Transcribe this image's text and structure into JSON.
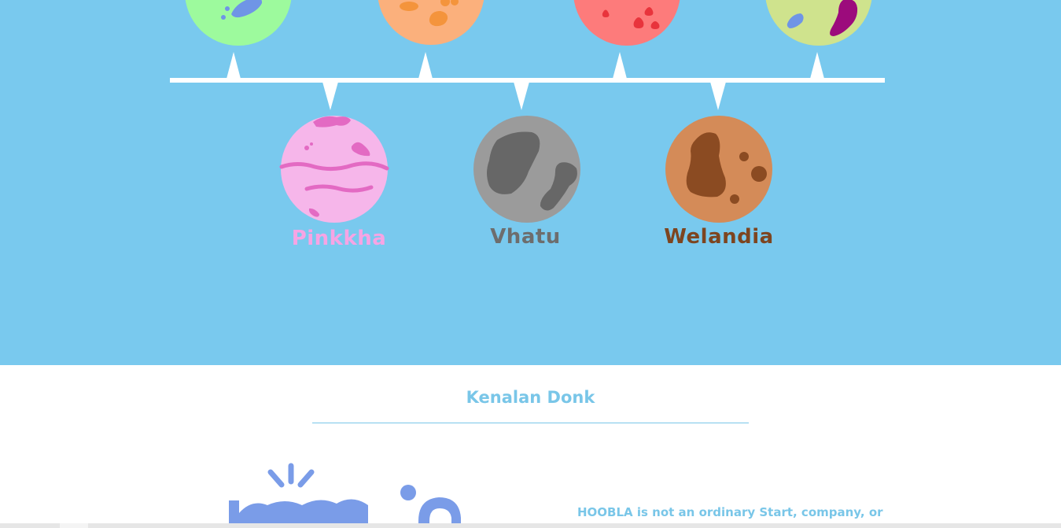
{
  "planet_section": {
    "background": "#79c9ee",
    "upper_planets": [
      {
        "id": "green",
        "color": "#9dfa9d",
        "spot_color": "#6f95e6"
      },
      {
        "id": "orange",
        "color": "#fbb07c",
        "spot_color": "#f4943c"
      },
      {
        "id": "red",
        "color": "#fd7b7b",
        "spot_color": "#e8343c"
      },
      {
        "id": "lime",
        "color": "#cfe38d",
        "spot_color": "#9c0b7c"
      }
    ],
    "lower_planets": [
      {
        "id": "pinkkha",
        "name": "Pinkkha",
        "color": "#f6b6ea",
        "spot_color": "#e36ac3",
        "label_color": "#f6a4e4"
      },
      {
        "id": "vhatu",
        "name": "Vhatu",
        "color": "#9b9b9b",
        "spot_color": "#676767",
        "label_color": "#6d6d6d"
      },
      {
        "id": "welandia",
        "name": "Welandia",
        "color": "#d48b58",
        "spot_color": "#8b4b22",
        "label_color": "#7d4520"
      }
    ],
    "timeline_color": "#ffffff"
  },
  "about": {
    "title": "Kenalan Donk",
    "text": "HOOBLA is not an ordinary Start, company, or",
    "accent_color": "#79c6e8",
    "logo_color": "#7a9ce8",
    "logo_icon": "hoobla-logo"
  }
}
